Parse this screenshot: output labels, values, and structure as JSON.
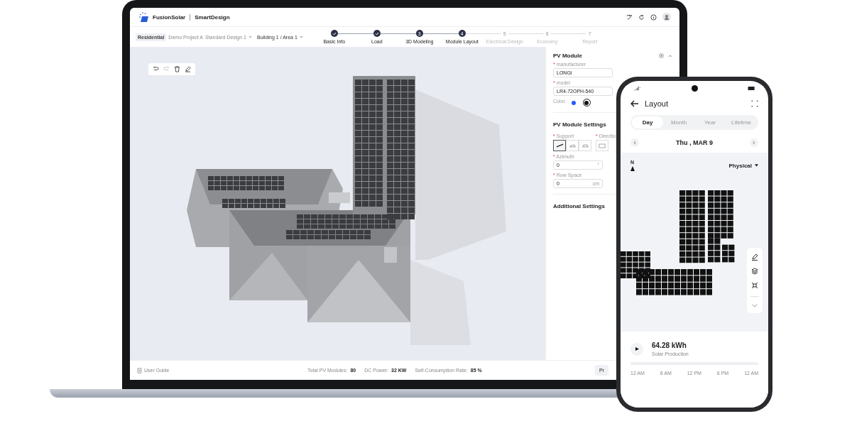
{
  "app": {
    "brand": "FusionSolar",
    "product": "SmartDesign"
  },
  "breadcrumb": {
    "tag": "Residential",
    "project": "Demo Project A",
    "design": "Standard Design 1",
    "building": "Building 1 / Area 1"
  },
  "steps": [
    {
      "label": "Basic Info",
      "completed": true,
      "disabled": false
    },
    {
      "label": "Load",
      "completed": true,
      "disabled": false
    },
    {
      "number": "3",
      "label": "3D Modeling",
      "completed": false,
      "disabled": false
    },
    {
      "number": "4",
      "label": "Module Layout",
      "completed": false,
      "disabled": false
    },
    {
      "number": "5",
      "label": "Electrical Design",
      "completed": false,
      "disabled": true
    },
    {
      "number": "6",
      "label": "Economy",
      "completed": false,
      "disabled": true
    },
    {
      "number": "7",
      "label": "Report",
      "completed": false,
      "disabled": true
    }
  ],
  "panel": {
    "title": "PV Module",
    "required_mark": "*",
    "fields": [
      {
        "label": "manufacturer",
        "required": true,
        "value": "LONGi"
      },
      {
        "label": "model",
        "required": true,
        "value": "LR4-72OPH-540"
      }
    ],
    "color_label": "Color",
    "colors": [
      {
        "color": "#1f5cff",
        "selected": false
      },
      {
        "color": "#111111",
        "selected": true
      }
    ],
    "settings_title": "PV Module Settings",
    "support_label": "Support",
    "support_options": [
      {
        "selected": true
      },
      {
        "selected": false
      },
      {
        "selected": false
      }
    ],
    "direction_label": "Directio",
    "azimuth": {
      "label": "Azimuth",
      "value": "0",
      "unit": "°"
    },
    "row_space": {
      "label": "Row Space",
      "value": "0",
      "unit": "cm"
    },
    "additional": "Additional Settings"
  },
  "footer": {
    "user_guide": "User Guide",
    "stats": [
      {
        "label": "Total PV Modules:",
        "value": "80"
      },
      {
        "label": "DC Power:",
        "value": "32 KW"
      },
      {
        "label": "Self-Consumption Rate:",
        "value": "85 %"
      }
    ],
    "button": "Pr"
  },
  "phone": {
    "title": "Layout",
    "tabs": [
      {
        "label": "Day",
        "selected": true
      },
      {
        "label": "Month",
        "selected": false
      },
      {
        "label": "Year",
        "selected": false
      },
      {
        "label": "Lifetime",
        "selected": false
      }
    ],
    "date": "Thu , MAR 9",
    "compass": "N",
    "view": "Physical",
    "energy": "64.28 kWh",
    "energy_label": "Solar Production",
    "timeline_labels": [
      "12 AM",
      "6 AM",
      "12 PM",
      "6 PM",
      "12 AM"
    ]
  }
}
